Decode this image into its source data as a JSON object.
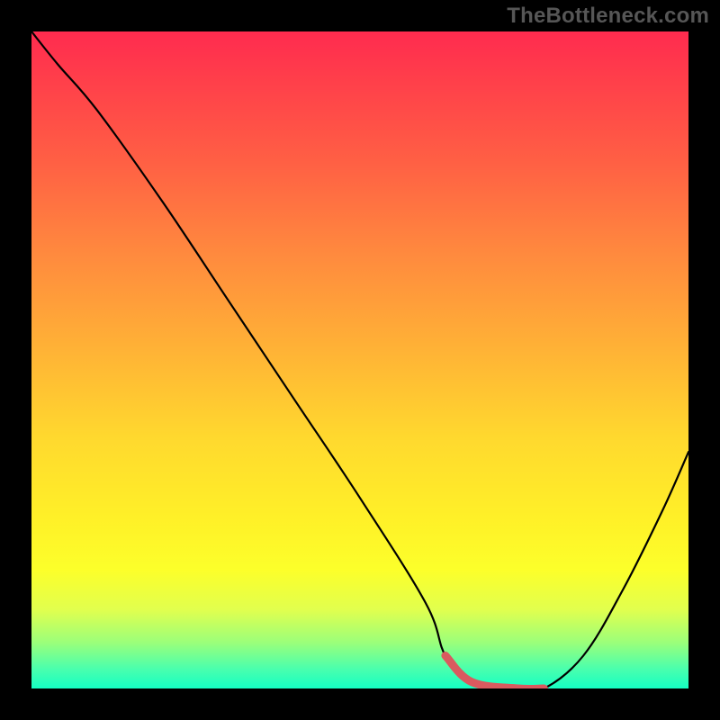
{
  "watermark": "TheBottleneck.com",
  "colors": {
    "background": "#000000",
    "watermark": "#565656",
    "curve": "#000000",
    "sweet_spot": "#d95a5f",
    "gradient_top": "#ff2b4f",
    "gradient_bottom": "#15ffc3"
  },
  "chart_data": {
    "type": "line",
    "title": "",
    "xlabel": "",
    "ylabel": "",
    "xlim": [
      0,
      100
    ],
    "ylim": [
      0,
      100
    ],
    "grid": false,
    "series": [
      {
        "name": "bottleneck-curve",
        "x": [
          0,
          4,
          10,
          20,
          30,
          40,
          50,
          60,
          63,
          67,
          74,
          78,
          84,
          90,
          96,
          100
        ],
        "values": [
          100,
          95,
          88,
          74,
          59,
          44,
          29,
          13,
          5,
          1,
          0,
          0,
          5,
          15,
          27,
          36
        ]
      }
    ],
    "sweet_spot_range_x": [
      63,
      78
    ],
    "annotations": []
  }
}
